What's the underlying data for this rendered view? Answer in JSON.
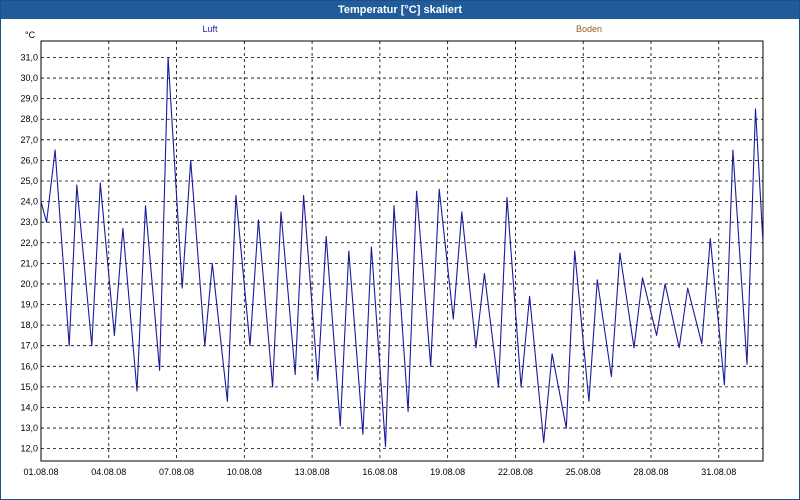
{
  "window": {
    "title": "Temperatur [°C] skaliert"
  },
  "chart_data": {
    "type": "line",
    "title": "Temperatur [°C] skaliert",
    "ylabel": "°C",
    "ylim": [
      11.4,
      31.8
    ],
    "xlim": [
      "2008-08-01",
      "2008-09-01T23:00"
    ],
    "grid": true,
    "legend": [
      {
        "name": "Luft",
        "color": "#1a1a9a",
        "position": "top-left"
      },
      {
        "name": "Boden",
        "color": "#9a5a1a",
        "position": "top-right"
      }
    ],
    "x_ticks": [
      "01.08.08",
      "04.08.08",
      "07.08.08",
      "10.08.08",
      "13.08.08",
      "16.08.08",
      "19.08.08",
      "22.08.08",
      "25.08.08",
      "28.08.08",
      "31.08.08"
    ],
    "y_ticks": [
      "12,0",
      "13,0",
      "14,0",
      "15,0",
      "16,0",
      "17,0",
      "18,0",
      "19,0",
      "20,0",
      "21,0",
      "22,0",
      "23,0",
      "24,0",
      "25,0",
      "26,0",
      "27,0",
      "28,0",
      "29,0",
      "30,0",
      "31,0"
    ],
    "series": [
      {
        "name": "Luft",
        "color": "#1a1a9a",
        "x": [
          "2008-08-01T00:00",
          "2008-08-01T06:00",
          "2008-08-01T15:00",
          "2008-08-02T06:00",
          "2008-08-02T14:00",
          "2008-08-03T06:00",
          "2008-08-03T15:00",
          "2008-08-04T06:00",
          "2008-08-04T15:00",
          "2008-08-05T06:00",
          "2008-08-05T15:00",
          "2008-08-06T06:00",
          "2008-08-06T15:00",
          "2008-08-07T06:00",
          "2008-08-07T15:00",
          "2008-08-08T06:00",
          "2008-08-08T14:00",
          "2008-08-09T06:00",
          "2008-08-09T15:00",
          "2008-08-10T06:00",
          "2008-08-10T15:00",
          "2008-08-11T06:00",
          "2008-08-11T15:00",
          "2008-08-12T06:00",
          "2008-08-12T15:00",
          "2008-08-13T06:00",
          "2008-08-13T15:00",
          "2008-08-14T06:00",
          "2008-08-14T15:00",
          "2008-08-15T06:00",
          "2008-08-15T15:00",
          "2008-08-16T06:00",
          "2008-08-16T15:00",
          "2008-08-17T06:00",
          "2008-08-17T15:00",
          "2008-08-18T06:00",
          "2008-08-18T15:00",
          "2008-08-19T06:00",
          "2008-08-19T15:00",
          "2008-08-20T06:00",
          "2008-08-20T15:00",
          "2008-08-21T06:00",
          "2008-08-21T15:00",
          "2008-08-22T06:00",
          "2008-08-22T15:00",
          "2008-08-23T06:00",
          "2008-08-23T15:00",
          "2008-08-24T06:00",
          "2008-08-24T15:00",
          "2008-08-25T06:00",
          "2008-08-25T15:00",
          "2008-08-26T06:00",
          "2008-08-26T15:00",
          "2008-08-27T06:00",
          "2008-08-27T15:00",
          "2008-08-28T06:00",
          "2008-08-28T15:00",
          "2008-08-29T06:00",
          "2008-08-29T15:00",
          "2008-08-30T06:00",
          "2008-08-30T15:00",
          "2008-08-31T06:00",
          "2008-08-31T15:00",
          "2008-09-01T06:00",
          "2008-09-01T15:00",
          "2008-09-01T23:00"
        ],
        "values": [
          24.0,
          23.0,
          26.5,
          17.0,
          24.8,
          17.0,
          24.9,
          17.5,
          22.7,
          14.8,
          23.8,
          15.8,
          31.0,
          19.8,
          26.0,
          17.0,
          21.0,
          14.3,
          24.3,
          17.0,
          23.1,
          15.0,
          23.5,
          15.6,
          24.3,
          15.3,
          22.3,
          13.1,
          21.6,
          12.7,
          21.8,
          12.1,
          23.8,
          13.8,
          24.5,
          16.0,
          24.6,
          18.3,
          23.5,
          16.9,
          20.5,
          15.0,
          24.2,
          15.0,
          19.4,
          12.3,
          16.6,
          13.0,
          21.6,
          14.3,
          20.2,
          15.5,
          21.5,
          16.9,
          20.3,
          17.5,
          20.0,
          16.9,
          19.8,
          17.1,
          22.2,
          15.1,
          26.5,
          16.1,
          28.5,
          22.0
        ]
      },
      {
        "name": "Boden",
        "color": "#9a5a1a",
        "x": [],
        "values": []
      }
    ]
  }
}
